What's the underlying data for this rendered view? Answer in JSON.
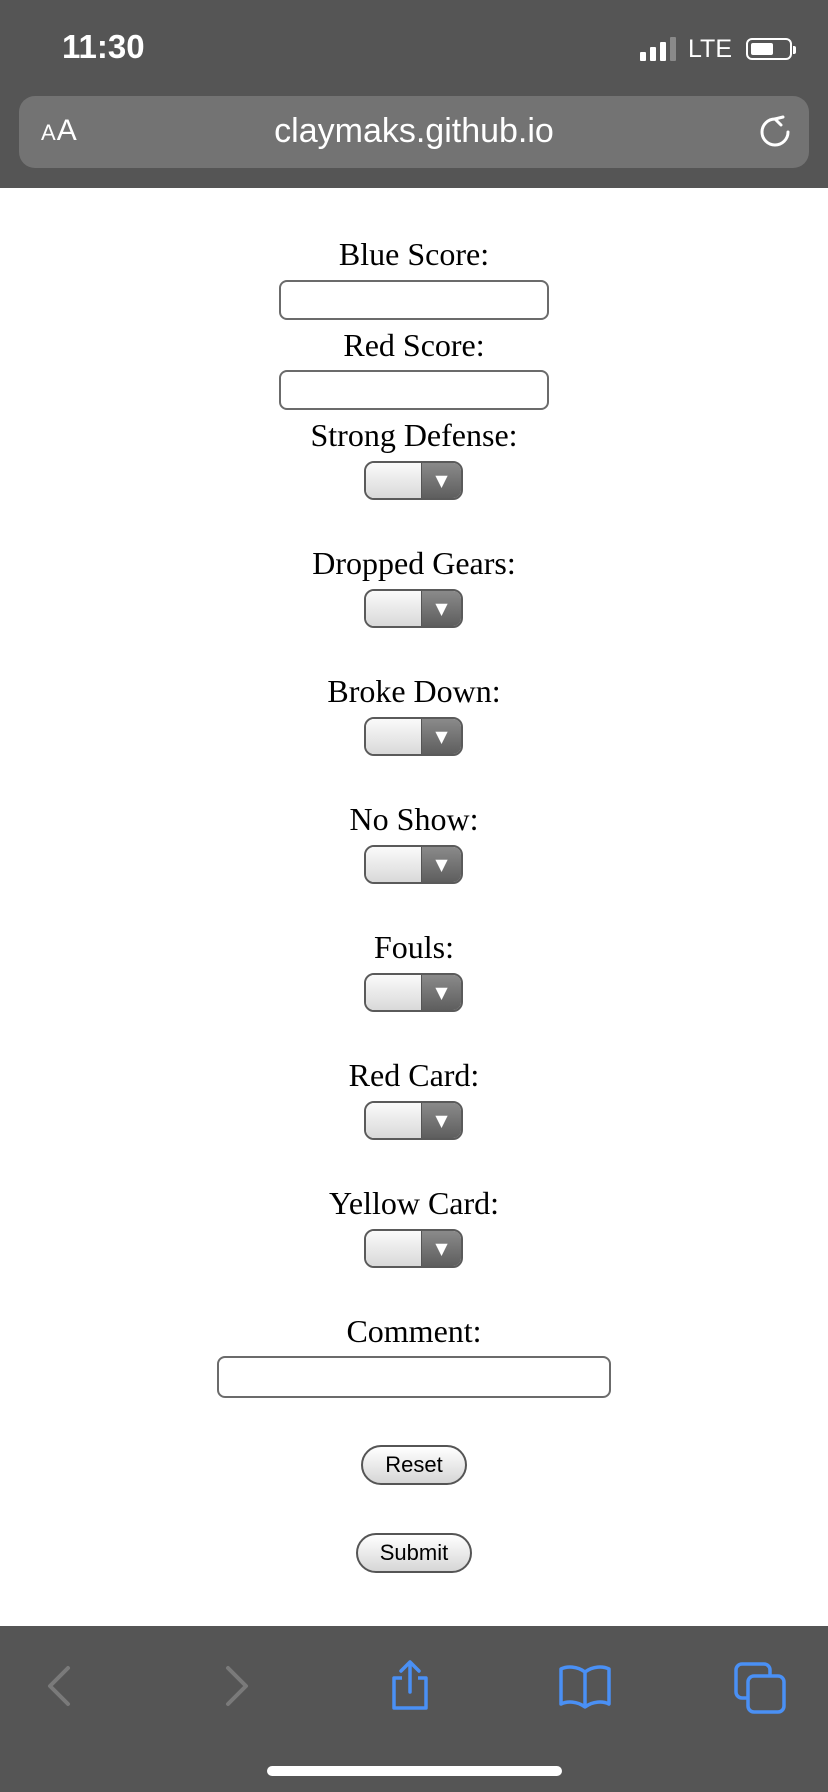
{
  "status_bar": {
    "time": "11:30",
    "network": "LTE",
    "signal_bars": 3,
    "signal_bars_total": 4,
    "battery_level": 0.6
  },
  "browser": {
    "text_size_label": "AA",
    "url": "claymaks.github.io",
    "reload_icon": "reload-icon"
  },
  "form": {
    "blue_score_label": "Blue Score:",
    "blue_score_value": "",
    "red_score_label": "Red Score:",
    "red_score_value": "",
    "strong_defense_label": "Strong Defense:",
    "strong_defense_value": "",
    "dropped_gears_label": "Dropped Gears:",
    "dropped_gears_value": "",
    "broke_down_label": "Broke Down:",
    "broke_down_value": "",
    "no_show_label": "No Show:",
    "no_show_value": "",
    "fouls_label": "Fouls:",
    "fouls_value": "",
    "red_card_label": "Red Card:",
    "red_card_value": "",
    "yellow_card_label": "Yellow Card:",
    "yellow_card_value": "",
    "comment_label": "Comment:",
    "comment_value": "",
    "reset_label": "Reset",
    "submit_label": "Submit"
  },
  "toolbar": {
    "icons": [
      "back-icon",
      "forward-icon",
      "share-icon",
      "bookmarks-icon",
      "tabs-icon"
    ],
    "active_color": "#4a90f5",
    "disabled_color": "#7a7a7a"
  },
  "colors": {
    "chrome_background": "#555555",
    "urlbar_background": "#737373",
    "page_background": "#ffffff"
  }
}
